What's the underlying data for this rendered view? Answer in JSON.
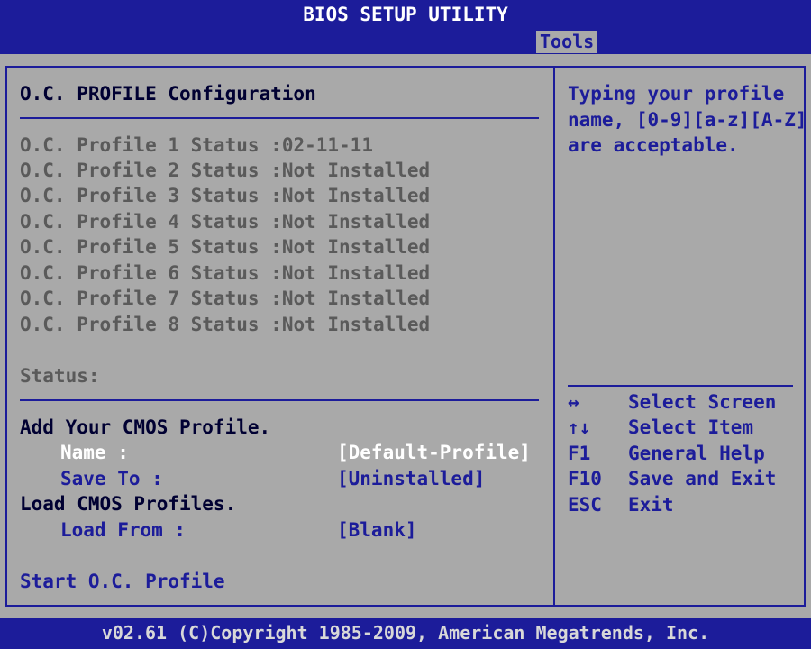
{
  "title": "BIOS SETUP UTILITY",
  "active_tab": "Tools",
  "section_title": "O.C. PROFILE Configuration",
  "profiles": [
    {
      "label": "O.C. Profile 1 Status",
      "value": ":02-11-11"
    },
    {
      "label": "O.C. Profile 2 Status",
      "value": ":Not Installed"
    },
    {
      "label": "O.C. Profile 3 Status",
      "value": ":Not Installed"
    },
    {
      "label": "O.C. Profile 4 Status",
      "value": ":Not Installed"
    },
    {
      "label": "O.C. Profile 5 Status",
      "value": ":Not Installed"
    },
    {
      "label": "O.C. Profile 6 Status",
      "value": ":Not Installed"
    },
    {
      "label": "O.C. Profile 7 Status",
      "value": ":Not Installed"
    },
    {
      "label": "O.C. Profile 8 Status",
      "value": ":Not Installed"
    }
  ],
  "status_label": "Status:",
  "add_profile": {
    "heading": "Add Your CMOS Profile.",
    "name_label": "Name :",
    "name_value": "[Default-Profile]",
    "save_label": "Save To :",
    "save_value": "[Uninstalled]"
  },
  "load_profile": {
    "heading": "Load CMOS Profiles.",
    "load_label": "Load From :",
    "load_value": "[Blank]"
  },
  "start_label": "Start O.C. Profile",
  "help": {
    "lines": [
      "Typing your profile",
      "name, [0-9][a-z][A-Z]",
      "are acceptable."
    ]
  },
  "keys": [
    {
      "key": "↔",
      "action": "Select Screen"
    },
    {
      "key": "↑↓",
      "action": "Select Item"
    },
    {
      "key": "F1",
      "action": "General Help"
    },
    {
      "key": "F10",
      "action": "Save and Exit"
    },
    {
      "key": "ESC",
      "action": "Exit"
    }
  ],
  "footer": "v02.61 (C)Copyright 1985-2009, American Megatrends, Inc.",
  "colors": {
    "bios_blue": "#1c1c9a",
    "panel_gray": "#a9a9a9",
    "highlight_white": "#ffffff",
    "inactive_text": "#5a5a5a",
    "text_dark": "#000032"
  }
}
